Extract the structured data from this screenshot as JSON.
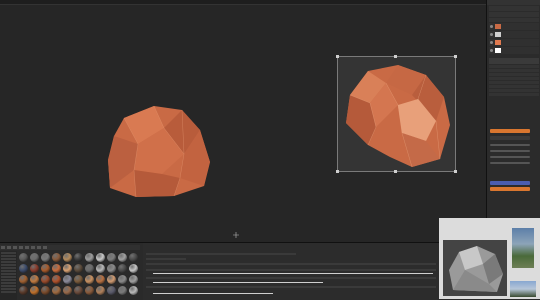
{
  "viewport": {
    "title": "",
    "rock_color": "#c96a45",
    "rock_highlight": "#e08a60",
    "gizmo_color": "#7a7a7a"
  },
  "right_panel": {
    "header": "",
    "layers": [
      {
        "name": "",
        "thumb": "#c96a45"
      },
      {
        "name": "",
        "thumb": "#d0d0d0"
      },
      {
        "name": "",
        "thumb": "#e07a50"
      },
      {
        "name": "",
        "thumb": "#ffffff"
      }
    ],
    "accent_bars": [
      {
        "color": "#d9762f"
      },
      {
        "color": "#4a5db0"
      },
      {
        "color": "#d9762f"
      }
    ]
  },
  "shelf": {
    "ball_colors": [
      "#5a5a5a",
      "#6c6c6c",
      "#7a7a7a",
      "#8a5a3a",
      "#b48a5a",
      "#3a3a3a",
      "#9b9b9b",
      "#c8c8c8",
      "#7d7d7d",
      "#a0a0a0",
      "#4a4a4a",
      "#3a4a6a",
      "#8a3a2a",
      "#a85a2a",
      "#c86a3a",
      "#d8a070",
      "#5a4a3a",
      "#6a6a6a",
      "#b8b8b8",
      "#8a8a8a",
      "#4a4a4a",
      "#c8c8c8",
      "#a06030",
      "#c07a40",
      "#9a4a2a",
      "#b0502a",
      "#8a8a9a",
      "#7a5a3a",
      "#c89060",
      "#b87040",
      "#d09a70",
      "#8a8a8a",
      "#a0a0a0",
      "#5a3a2a",
      "#c0702a",
      "#7a4a2a",
      "#a06a40",
      "#9a6a4a",
      "#6a4a3a",
      "#8a5a3a",
      "#b0805a",
      "#5a5a6a",
      "#7a7a7a",
      "#bababa"
    ]
  },
  "properties": {
    "title": ""
  }
}
